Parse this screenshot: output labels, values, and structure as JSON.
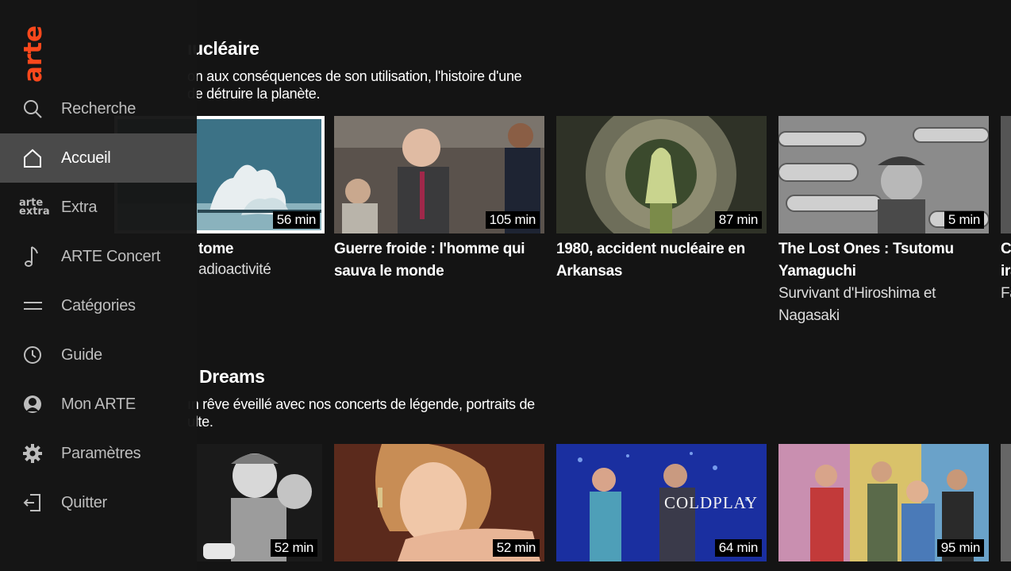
{
  "app": {
    "logo_text": "arte"
  },
  "sidebar": {
    "items": [
      {
        "label": "Recherche",
        "icon": "search-icon"
      },
      {
        "label": "Accueil",
        "icon": "home-icon",
        "active": true
      },
      {
        "label": "Extra",
        "icon": "arte-extra-icon",
        "icon_text": "arte extra"
      },
      {
        "label": "ARTE Concert",
        "icon": "music-note-icon"
      },
      {
        "label": "Catégories",
        "icon": "menu-lines-icon"
      },
      {
        "label": "Guide",
        "icon": "clock-icon"
      },
      {
        "label": "Mon ARTE",
        "icon": "user-icon"
      },
      {
        "label": "Paramètres",
        "icon": "gear-icon"
      },
      {
        "label": "Quitter",
        "icon": "exit-icon"
      }
    ]
  },
  "rows": [
    {
      "title": "ıucléaire",
      "description": "on aux conséquences de son utilisation, l'histoire d'une de détruire la planète.",
      "cards": [
        {
          "title": "tome",
          "subtitle": "adioactivité",
          "duration": "56 min",
          "focused": true
        },
        {
          "title": "Guerre froide : l'homme qui sauva le monde",
          "subtitle": "",
          "duration": "105 min"
        },
        {
          "title": "1980, accident nucléaire en Arkansas",
          "subtitle": "",
          "duration": "87 min"
        },
        {
          "title": "The Lost Ones : Tsutomu Yamaguchi",
          "subtitle": "Survivant d'Hiroshima et Nagasaki",
          "duration": "5 min"
        },
        {
          "title": "Ca ira",
          "subtitle": "Fa",
          "duration": ""
        }
      ]
    },
    {
      "title": "Dreams",
      "description": "ın rêve éveillé avec nos concerts de légende, portraits de ulte.",
      "cards": [
        {
          "title": "",
          "subtitle": "",
          "duration": "52 min"
        },
        {
          "title": "",
          "subtitle": "",
          "duration": "52 min"
        },
        {
          "title": "",
          "subtitle": "",
          "duration": "64 min",
          "thumb_text": "COLDPLAY"
        },
        {
          "title": "",
          "subtitle": "",
          "duration": "95 min"
        }
      ]
    }
  ],
  "colors": {
    "brand": "#fa481c",
    "background": "#141414",
    "sidebar_active": "#4a4a4a"
  }
}
